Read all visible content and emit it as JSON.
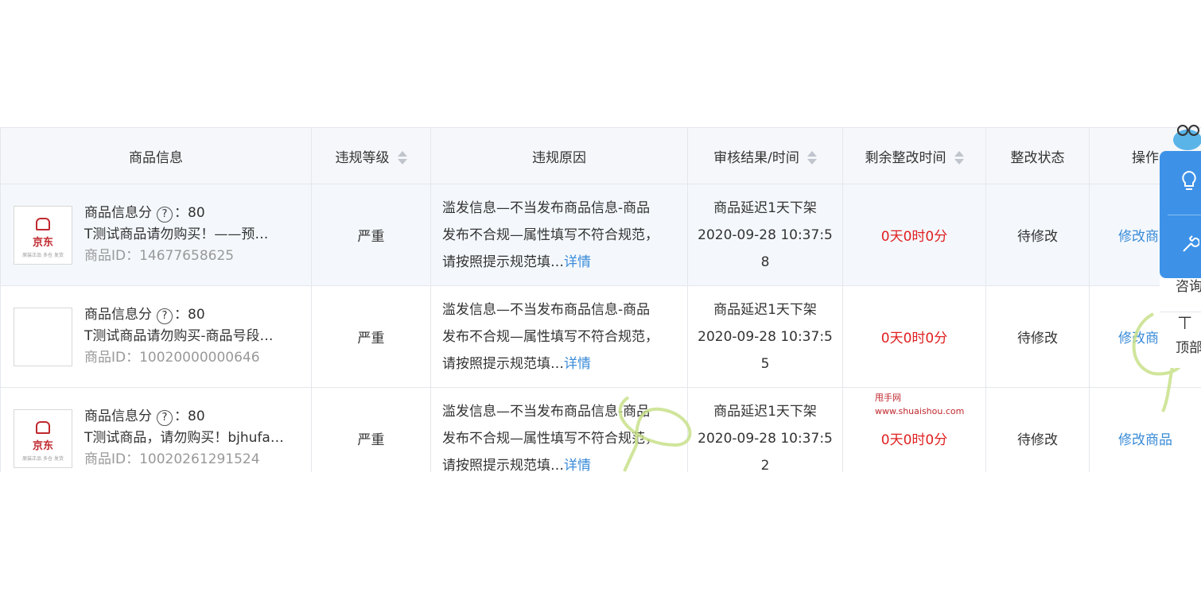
{
  "columns": [
    {
      "label": "商品信息",
      "sortable": false
    },
    {
      "label": "违规等级",
      "sortable": true
    },
    {
      "label": "违规原因",
      "sortable": false
    },
    {
      "label": "审核结果/时间",
      "sortable": true
    },
    {
      "label": "剩余整改时间",
      "sortable": true
    },
    {
      "label": "整改状态",
      "sortable": false
    },
    {
      "label": "操作",
      "sortable": false
    }
  ],
  "rows": [
    {
      "score_label": "商品信息分",
      "score_sep": "：",
      "score": "80",
      "title": "T测试商品请勿购买！——预…",
      "product_id": "商品ID：14677658625",
      "thumb": "jd",
      "level": "严重",
      "reason_l1": "滥发信息—不当发布商品信息-商品",
      "reason_l2": "发布不合规—属性填写不符合规范，",
      "reason_l3": "请按照提示规范填…",
      "detail": "详情",
      "audit_result": "商品延迟1天下架",
      "audit_time_l1": "2020-09-28 10:37:5",
      "audit_time_l2": "8",
      "remaining": "0天0时0分",
      "status": "待修改",
      "action": "修改商品"
    },
    {
      "score_label": "商品信息分",
      "score_sep": "：",
      "score": "80",
      "title": "T测试商品请勿购买-商品号段…",
      "product_id": "商品ID：10020000000646",
      "thumb": "blank",
      "level": "严重",
      "reason_l1": "滥发信息—不当发布商品信息-商品",
      "reason_l2": "发布不合规—属性填写不符合规范，",
      "reason_l3": "请按照提示规范填…",
      "detail": "详情",
      "audit_result": "商品延迟1天下架",
      "audit_time_l1": "2020-09-28 10:37:5",
      "audit_time_l2": "5",
      "remaining": "0天0时0分",
      "status": "待修改",
      "action": "修改商品"
    },
    {
      "score_label": "商品信息分",
      "score_sep": "：",
      "score": "80",
      "title": "T测试商品，请勿购买！bjhufa…",
      "product_id": "商品ID：10020261291524",
      "thumb": "jd",
      "level": "严重",
      "reason_l1": "滥发信息—不当发布商品信息-商品",
      "reason_l2": "发布不合规—属性填写不符合规范，",
      "reason_l3": "请按照提示规范填…",
      "detail": "详情",
      "audit_result": "商品延迟1天下架",
      "audit_time_l1": "2020-09-28 10:37:5",
      "audit_time_l2": "2",
      "remaining": "0天0时0分",
      "status": "待修改",
      "action": "修改商品"
    }
  ],
  "thumb_brand": "京东",
  "thumb_tag": "原装正品  多仓 发货",
  "side": {
    "consult": "咨询",
    "top": "顶部"
  },
  "watermark": {
    "line1": "甩手网",
    "line2": "www.shuaishou.com"
  },
  "colors": {
    "accent": "#3a8bd8",
    "danger": "#e02020",
    "panel": "#3d92e8"
  }
}
